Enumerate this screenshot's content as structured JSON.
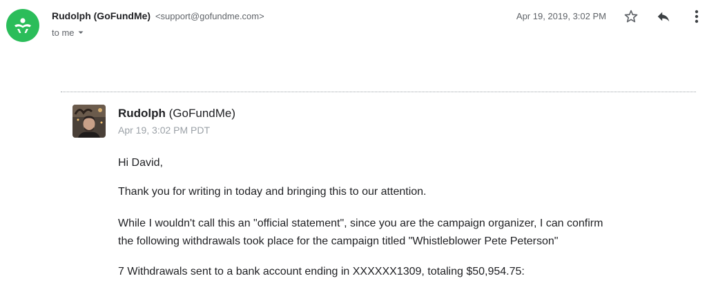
{
  "header": {
    "sender_name": "Rudolph (GoFundMe)",
    "sender_email": "<support@gofundme.com>",
    "recipient": "to me",
    "date": "Apr 19, 2019, 3:02 PM"
  },
  "icons": {
    "avatar": "gofundme-logo-icon",
    "star": "star-icon",
    "reply": "reply-icon",
    "more": "more-vert-icon",
    "dropdown": "caret-down-icon"
  },
  "colors": {
    "brand_green": "#2bbd5a",
    "muted_text": "#5f6368",
    "light_text": "#9aa0a6"
  },
  "quoted": {
    "name_bold": "Rudolph",
    "name_rest": " (GoFundMe)",
    "date": "Apr 19, 3:02 PM PDT",
    "greeting": "Hi David,",
    "paragraph1": "Thank you for writing in today and bringing this to our attention.",
    "paragraph2_line1": "While I wouldn't call this an \"official statement\", since you are the campaign organizer, I can confirm",
    "paragraph2_line2": "the following withdrawals took place for the campaign titled \"Whistleblower Pete Peterson\"",
    "paragraph3": "7 Withdrawals sent to a bank account ending in XXXXXX1309, totaling $50,954.75:"
  }
}
